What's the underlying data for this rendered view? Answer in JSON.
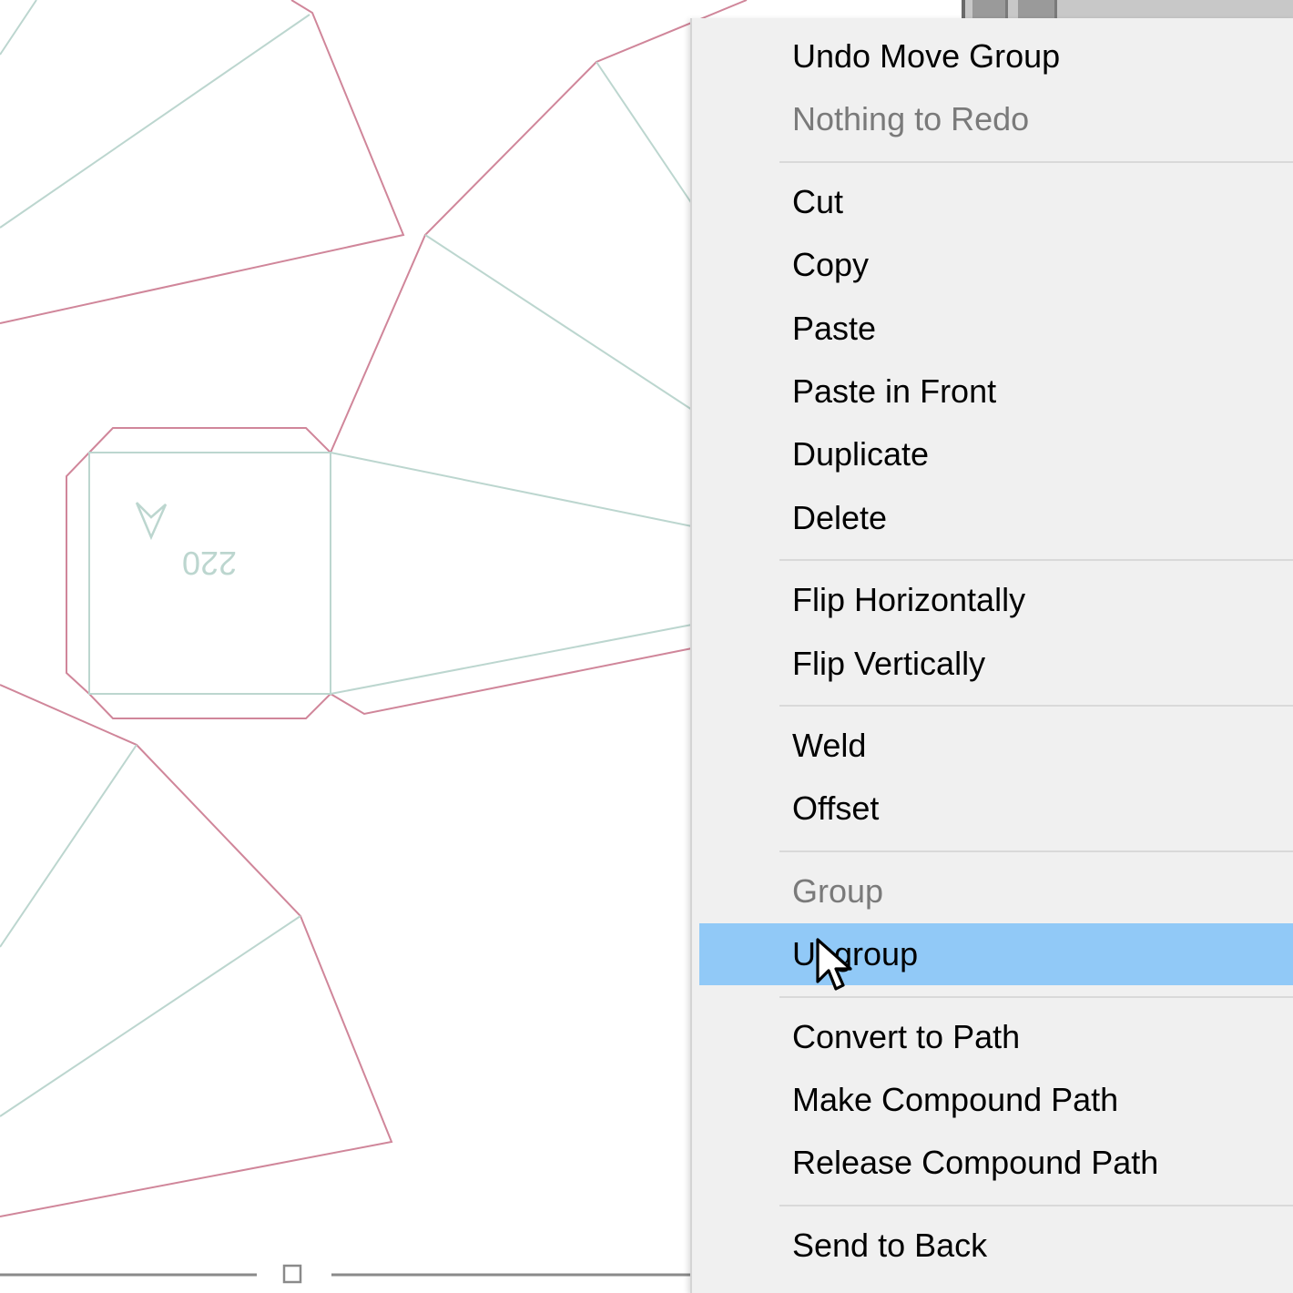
{
  "canvas": {
    "part_number": "220",
    "colors": {
      "cut_line": "#d0869a",
      "fold_line": "#bcd6cf",
      "scrollbar": "#8a8a8a"
    }
  },
  "context_menu": {
    "highlight_color": "#91c9f7",
    "items": [
      {
        "label": "Undo Move Group",
        "enabled": true
      },
      {
        "label": "Nothing to Redo",
        "enabled": false
      },
      {
        "separator": true
      },
      {
        "label": "Cut",
        "enabled": true
      },
      {
        "label": "Copy",
        "enabled": true
      },
      {
        "label": "Paste",
        "enabled": true
      },
      {
        "label": "Paste in Front",
        "enabled": true
      },
      {
        "label": "Duplicate",
        "enabled": true
      },
      {
        "label": "Delete",
        "enabled": true
      },
      {
        "separator": true
      },
      {
        "label": "Flip Horizontally",
        "enabled": true
      },
      {
        "label": "Flip Vertically",
        "enabled": true
      },
      {
        "separator": true
      },
      {
        "label": "Weld",
        "enabled": true
      },
      {
        "label": "Offset",
        "enabled": true
      },
      {
        "separator": true
      },
      {
        "label": "Group",
        "enabled": false
      },
      {
        "label": "Ungroup",
        "enabled": true,
        "hovered": true
      },
      {
        "separator": true
      },
      {
        "label": "Convert to Path",
        "enabled": true
      },
      {
        "label": "Make Compound Path",
        "enabled": true
      },
      {
        "label": "Release Compound Path",
        "enabled": true
      },
      {
        "separator": true
      },
      {
        "label": "Send to Back",
        "enabled": true
      }
    ]
  },
  "cursor": {
    "icon": "arrow-pointer-icon"
  }
}
